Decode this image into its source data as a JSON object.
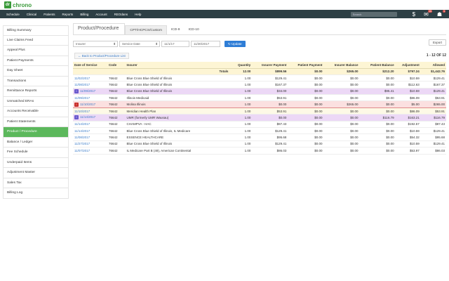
{
  "app": {
    "logo_mark": "dr",
    "logo_text": "chrono"
  },
  "nav": {
    "items": [
      "Schedule",
      "Clinical",
      "Patients",
      "Reports",
      "Billing",
      "Account",
      "REOdans",
      "Help"
    ],
    "search_placeholder": "Search",
    "icons": [
      "dollar-icon",
      "mail-icon",
      "user-icon"
    ],
    "mail_badge": "19",
    "user_badge": "1"
  },
  "sidebar": {
    "items": [
      {
        "label": "Billing Summary",
        "active": false
      },
      {
        "label": "Live Claims Feed",
        "active": false
      },
      {
        "label": "Appeal Plus",
        "active": false
      },
      {
        "label": "Patient Payments",
        "active": false
      },
      {
        "label": "Day Sheet",
        "active": false
      },
      {
        "label": "Transactions",
        "active": false
      },
      {
        "label": "Remittance Reports",
        "active": false
      },
      {
        "label": "Unmatched ERAs",
        "active": false
      },
      {
        "label": "Accounts Receivable",
        "active": false
      },
      {
        "label": "Patient Statements",
        "active": false
      },
      {
        "label": "Product / Procedure",
        "active": true
      },
      {
        "label": "Balance / Ledger",
        "active": false
      },
      {
        "label": "Fee Schedule",
        "active": false
      },
      {
        "label": "Underpaid Items",
        "active": false
      },
      {
        "label": "Adjustment Master",
        "active": false
      },
      {
        "label": "Sales Tax",
        "active": false
      },
      {
        "label": "Billing Log",
        "active": false
      }
    ]
  },
  "main": {
    "title": "Product/Procedure",
    "tabs": [
      {
        "label": "CPT/HCPCS/Custom",
        "active": true
      },
      {
        "label": "ICD-9",
        "active": false
      },
      {
        "label": "ICD-10",
        "active": false
      }
    ],
    "filters": {
      "payer": "Insurer",
      "date_type": "Service Date",
      "from": "11/1/17",
      "to": "11/30/2017",
      "update_label": "Update",
      "export_label": "Export"
    },
    "back_label": "Back to Product/Procedure List",
    "page_count": "1 - 12 OF 12"
  },
  "table": {
    "headers": [
      "Date of Service",
      "Code",
      "Insurer",
      "Quantity",
      "Insurer Payment",
      "Patient Payment",
      "Insurer Balance",
      "Patient Balance",
      "Adjustment",
      "Allowed"
    ],
    "totals": {
      "label": "Totals",
      "quantity": "12.00",
      "ins_pay": "$899.56",
      "pat_pay": "$0.00",
      "ins_bal": "$265.00",
      "pat_bal": "$212.20",
      "adj": "$797.24",
      "allowed": "$1,442.76"
    },
    "rows": [
      {
        "date": "11/02/2017",
        "code": "76642",
        "insurer": "Blue Cross Blue Shield of Illinois",
        "qty": "1.00",
        "ins_pay": "$129.41",
        "pat_pay": "$0.00",
        "ins_bal": "$0.00",
        "pat_bal": "$0.00",
        "adj": "$10.59",
        "allowed": "$129.41",
        "style": "",
        "badge": ""
      },
      {
        "date": "11/08/2017",
        "code": "76642",
        "insurer": "Blue Cross Blue Shield of Illinois",
        "qty": "1.00",
        "ins_pay": "$167.37",
        "pat_pay": "$0.00",
        "ins_bal": "$0.00",
        "pat_bal": "$0.00",
        "adj": "$112.63",
        "allowed": "$167.37",
        "style": "",
        "badge": ""
      },
      {
        "date": "11/09/2017",
        "code": "76642",
        "insurer": "Blue Cross Blue Shield of Illinois",
        "qty": "1.00",
        "ins_pay": "$34.00",
        "pat_pay": "$0.00",
        "ins_bal": "$0.00",
        "pat_bal": "$95.41",
        "adj": "$10.59",
        "allowed": "$129.41",
        "style": "purple",
        "badge": "I"
      },
      {
        "date": "11/09/2017",
        "code": "76642",
        "insurer": "Illinois Medicaid",
        "qty": "1.00",
        "ins_pay": "$53.91",
        "pat_pay": "$0.00",
        "ins_bal": "$0.00",
        "pat_bal": "$0.00",
        "adj": "$86.09",
        "allowed": "$53.91",
        "style": "",
        "badge": ""
      },
      {
        "date": "11/10/2017",
        "code": "76642",
        "insurer": "Molina Illinois",
        "qty": "1.00",
        "ins_pay": "$0.00",
        "pat_pay": "$0.00",
        "ins_bal": "$265.00",
        "pat_bal": "$0.00",
        "adj": "$5.00",
        "allowed": "$265.00",
        "style": "red",
        "badge": "!"
      },
      {
        "date": "11/10/2017",
        "code": "76642",
        "insurer": "Meridian Health Plan",
        "qty": "1.00",
        "ins_pay": "$53.91",
        "pat_pay": "$0.00",
        "ins_bal": "$0.00",
        "pat_bal": "$0.00",
        "adj": "$86.09",
        "allowed": "$53.91",
        "style": "yellow",
        "badge": ""
      },
      {
        "date": "11/14/2017",
        "code": "76642",
        "insurer": "UMR (formerly UMR Wausau)",
        "qty": "1.00",
        "ins_pay": "$0.00",
        "pat_pay": "$0.00",
        "ins_bal": "$0.00",
        "pat_bal": "$116.79",
        "adj": "$163.21",
        "allowed": "$116.79",
        "style": "purple",
        "badge": "I"
      },
      {
        "date": "11/14/2017",
        "code": "76642",
        "insurer": "CHAMPVA - HAC",
        "qty": "1.00",
        "ins_pay": "$87.43",
        "pat_pay": "$0.00",
        "ins_bal": "$0.00",
        "pat_bal": "$0.00",
        "adj": "$192.57",
        "allowed": "$87.43",
        "style": "",
        "badge": ""
      },
      {
        "date": "11/14/2017",
        "code": "76642",
        "insurer": "Blue Cross Blue Shield of Illinois, IL Medicare",
        "qty": "1.00",
        "ins_pay": "$129.41",
        "pat_pay": "$0.00",
        "ins_bal": "$0.00",
        "pat_bal": "$0.00",
        "adj": "$10.59",
        "allowed": "$129.41",
        "style": "",
        "badge": ""
      },
      {
        "date": "11/08/2017",
        "code": "76642",
        "insurer": "ESSENCE HEALTHCARE",
        "qty": "1.00",
        "ins_pay": "$95.68",
        "pat_pay": "$0.00",
        "ins_bal": "$0.00",
        "pat_bal": "$0.00",
        "adj": "$54.32",
        "allowed": "$95.68",
        "style": "",
        "badge": ""
      },
      {
        "date": "11/27/2017",
        "code": "76642",
        "insurer": "Blue Cross Blue Shield of Illinois",
        "qty": "1.00",
        "ins_pay": "$129.41",
        "pat_pay": "$0.00",
        "ins_bal": "$0.00",
        "pat_bal": "$0.00",
        "adj": "$10.59",
        "allowed": "$129.41",
        "style": "",
        "badge": ""
      },
      {
        "date": "11/07/2017",
        "code": "76642",
        "insurer": "IL Medicare Part B (49), American Continental",
        "qty": "1.00",
        "ins_pay": "$86.03",
        "pat_pay": "$0.00",
        "ins_bal": "$0.00",
        "pat_bal": "$0.00",
        "adj": "$53.97",
        "allowed": "$86.03",
        "style": "",
        "badge": ""
      }
    ]
  }
}
